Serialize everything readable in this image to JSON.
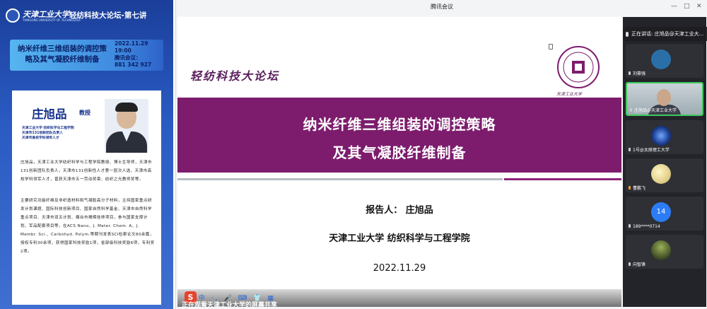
{
  "poster": {
    "university_cn": "天津工业大学",
    "university_en": "TIANGONG UNIVERSITY OF TECHNOLOGY",
    "forum_title": "轻纺科技大论坛-第七讲",
    "talk_title": "纳米纤维三维组装的调控策略及其气凝胶纤维制备",
    "date": "2022.11.29",
    "time": "19:00",
    "meeting_label": "腾讯会议：",
    "meeting_id": "881 342 927",
    "speaker_name": "庄旭品",
    "speaker_rank": "教授",
    "speaker_creds": [
      "天津工业大学 纺织科学与工程学院",
      "天津市131创新团队负责人",
      "天津市高校学科领军人才"
    ],
    "bio_1": "庄旭品，天津工业大学纺织科学与工程学院教授、博士生导师，天津市131创新团队负责人，天津市131创新性人才第一层次人选，天津市高校学科领军人才，曾获天津市五一劳动奖章、纺织之光教师奖等。",
    "bio_2": "主要研究功能纤维及非织造材料和气凝胶高分子材料，主持国家重点研发计划课题、国际科技创新项目、国家自然科学基金、天津市自然科学重点项目、天津市双五计划、烟台市揭榜挂帅项目，参与国家支撑计划、军品配套项目等，在ACS Nano、J. Mater. Chem. A、J. Membr. Sci.、Carbohyd. Polym.等期刊发表SCI检索论文80余篇，授权专利30余项，获得国家科技奖励1项，省部级科技奖励6项，专利奖2项。"
  },
  "window": {
    "title": "腾讯会议",
    "min_label": "—",
    "max_label": "□",
    "close_label": "✕"
  },
  "slide": {
    "forum": "轻纺科技大论坛",
    "logo_caption": "天津工业大学",
    "title_line1": "纳米纤维三维组装的调控策略",
    "title_line2": "及其气凝胶纤维制备",
    "reporter": "报告人：  庄旭品",
    "affiliation": "天津工业大学 纺织科学与工程学院",
    "date": "2022.11.29"
  },
  "taskbar": {
    "ime_logo": "S",
    "ime_items": "中 ·, 🎤 ⌨ 👕 ▦",
    "share_banner": "正在观看天津工业大学的屏幕共享"
  },
  "panel": {
    "speaking": "正在讲话: 庄旭品@天津工业大...",
    "participants": [
      {
        "name": "刘豪强",
        "avatar": "",
        "type": "avatar"
      },
      {
        "name": "庄旭品@天津工业大学",
        "avatar": "",
        "type": "video"
      },
      {
        "name": "1号@太原理工大学",
        "avatar": "",
        "type": "avatar"
      },
      {
        "name": "曹鹏飞",
        "avatar": "",
        "type": "avatar"
      },
      {
        "name": "189****0714",
        "avatar": "14",
        "type": "number"
      },
      {
        "name": "向智锋",
        "avatar": "",
        "type": "avatar"
      }
    ]
  },
  "colors": {
    "slide_purple": "#7d1c6d",
    "poster_blue": "#1b3f9a",
    "active_green": "#3ec95c"
  }
}
